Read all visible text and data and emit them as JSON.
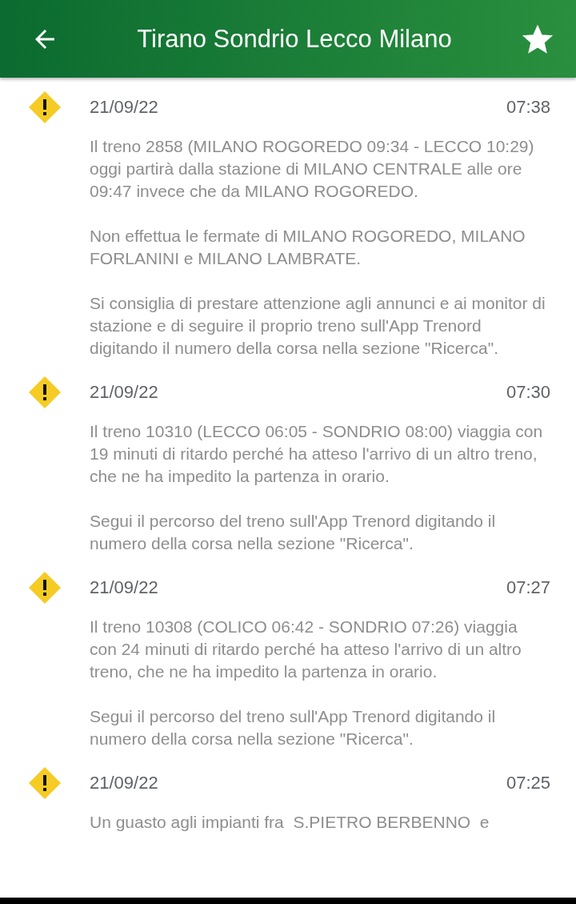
{
  "header": {
    "title": "Tirano Sondrio Lecco Milano",
    "favorite": true
  },
  "notices": [
    {
      "kind": "warning",
      "date": "21/09/22",
      "time": "07:38",
      "paragraphs": [
        "Il treno 2858 (MILANO ROGOREDO 09:34 - LECCO 10:29) oggi partirà dalla stazione di MILANO CENTRALE alle ore 09:47 invece che da MILANO ROGOREDO.",
        "Non effettua le fermate di MILANO ROGOREDO, MILANO FORLANINI e MILANO LAMBRATE.",
        "Si consiglia di prestare attenzione agli annunci e ai monitor di stazione e di seguire il proprio treno sull'App Trenord digitando il numero della corsa nella sezione \"Ricerca\"."
      ]
    },
    {
      "kind": "warning",
      "date": "21/09/22",
      "time": "07:30",
      "paragraphs": [
        "Il treno 10310 (LECCO 06:05 - SONDRIO 08:00) viaggia con 19 minuti di ritardo perché ha atteso l'arrivo di un altro treno, che ne ha impedito la partenza in orario.",
        "Segui il percorso del treno sull'App Trenord digitando il numero della corsa nella sezione \"Ricerca\"."
      ]
    },
    {
      "kind": "warning",
      "date": "21/09/22",
      "time": "07:27",
      "paragraphs": [
        "Il treno 10308 (COLICO 06:42 - SONDRIO 07:26) viaggia con 24 minuti di ritardo perché ha atteso l'arrivo di un altro treno, che ne ha impedito la partenza in orario.",
        "Segui il percorso del treno sull'App Trenord digitando il numero della corsa nella sezione \"Ricerca\"."
      ]
    },
    {
      "kind": "warning",
      "date": "21/09/22",
      "time": "07:25",
      "paragraphs": [
        "Un guasto agli impianti fra  S.PIETRO BERBENNO  e"
      ]
    }
  ]
}
